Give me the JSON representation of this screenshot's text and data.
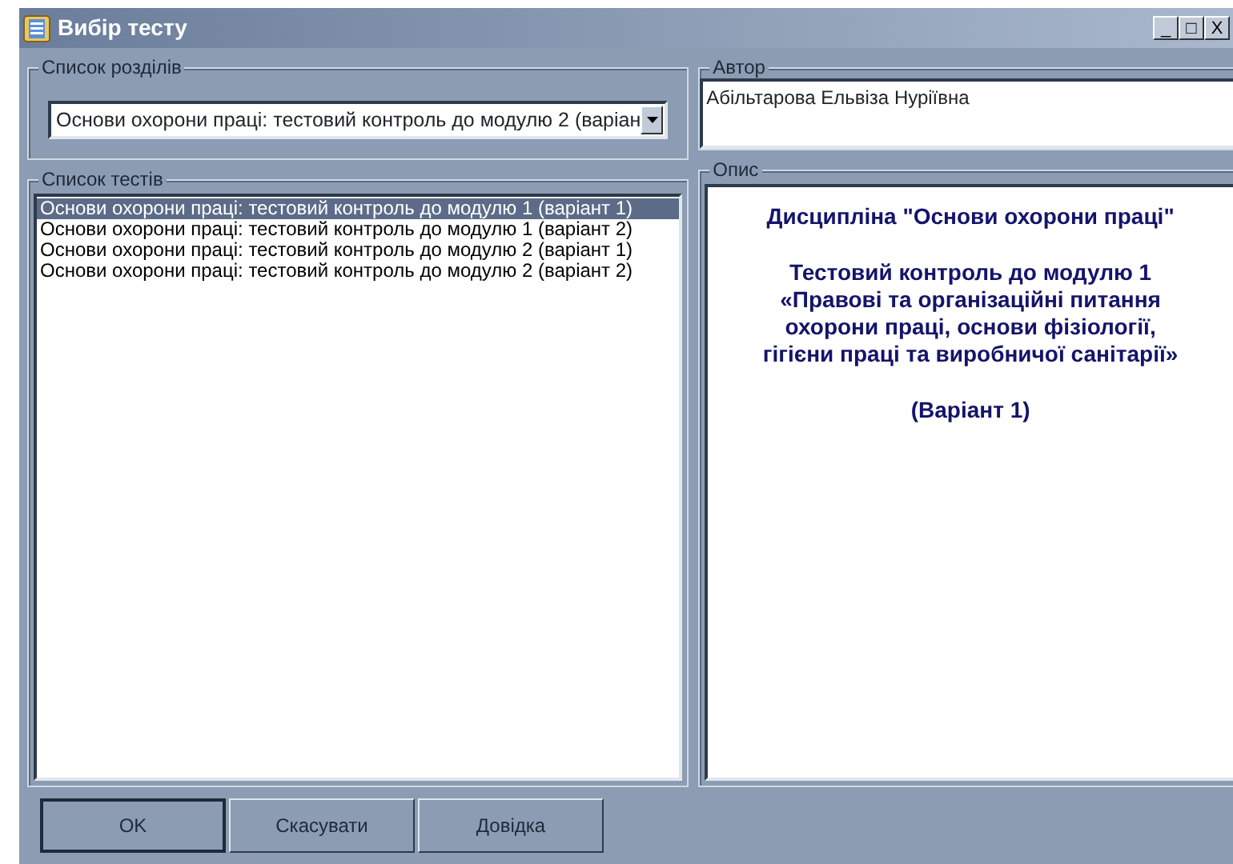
{
  "window": {
    "title": "Вибір тесту",
    "controls": [
      "_",
      "□",
      "X"
    ]
  },
  "sections": {
    "legend": "Список розділів",
    "value": "Основи охорони праці: тестовий контроль до модулю 2 (варіан"
  },
  "author": {
    "legend": "Автор",
    "value": "Абільтарова Ельвіза Нуріївна"
  },
  "tests": {
    "legend": "Список тестів",
    "items": [
      {
        "label": "Основи охорони праці: тестовий контроль до модулю 1 (варіант 1)",
        "selected": true
      },
      {
        "label": "Основи охорони праці: тестовий контроль до модулю 1 (варіант 2)",
        "selected": false
      },
      {
        "label": "Основи охорони праці: тестовий контроль до модулю  2 (варіант 1)",
        "selected": false
      },
      {
        "label": "Основи охорони праці: тестовий контроль до модулю  2 (варіант 2)",
        "selected": false
      }
    ]
  },
  "description": {
    "legend": "Опис",
    "paragraphs": [
      "Дисципліна \"Основи охорони праці\"",
      "Тестовий контроль до модулю 1",
      "«Правові та організаційні питання охорони праці, основи фізіології, гігієни праці та виробничої санітарії»",
      "(Варіант 1)"
    ]
  },
  "buttons": [
    "OK",
    "Скасувати",
    "Довідка"
  ]
}
